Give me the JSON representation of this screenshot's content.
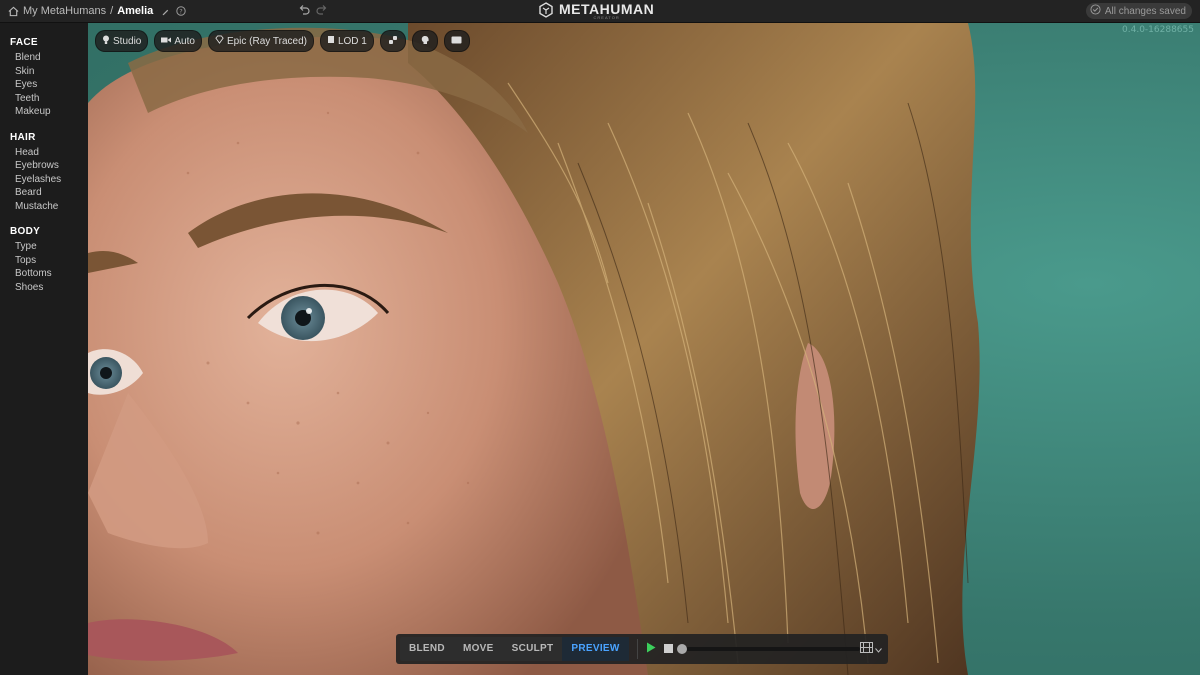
{
  "header": {
    "breadcrumb_root": "My MetaHumans",
    "separator": "/",
    "current": "Amelia",
    "logo_text": "METAHUMAN",
    "logo_sub": "CREATOR",
    "save_status": "All changes saved",
    "version": "0.4.0-16288655"
  },
  "sidebar": {
    "sections": [
      {
        "title": "FACE",
        "items": [
          "Blend",
          "Skin",
          "Eyes",
          "Teeth",
          "Makeup"
        ]
      },
      {
        "title": "HAIR",
        "items": [
          "Head",
          "Eyebrows",
          "Eyelashes",
          "Beard",
          "Mustache"
        ]
      },
      {
        "title": "BODY",
        "items": [
          "Type",
          "Tops",
          "Bottoms",
          "Shoes"
        ]
      }
    ]
  },
  "toolbar": {
    "lighting": "Studio",
    "camera": "Auto",
    "quality": "Epic (Ray Traced)",
    "lod": "LOD 1"
  },
  "modes": {
    "blend": "BLEND",
    "move": "MOVE",
    "sculpt": "SCULPT",
    "preview": "PREVIEW",
    "active": "PREVIEW"
  },
  "playback": {
    "progress": 0
  },
  "colors": {
    "accent": "#4aa3ff",
    "play": "#3ccf5c",
    "background_teal": "#3b8679"
  },
  "icons": [
    "home-icon",
    "edit-icon",
    "help-icon",
    "undo-icon",
    "redo-icon",
    "metahuman-logo-icon",
    "check-circle-icon",
    "bulb-icon",
    "camera-icon",
    "diamond-icon",
    "lod-icon",
    "link-icon",
    "head-icon",
    "keyboard-icon",
    "play-icon",
    "stop-icon",
    "film-icon",
    "chevron-down-icon"
  ]
}
